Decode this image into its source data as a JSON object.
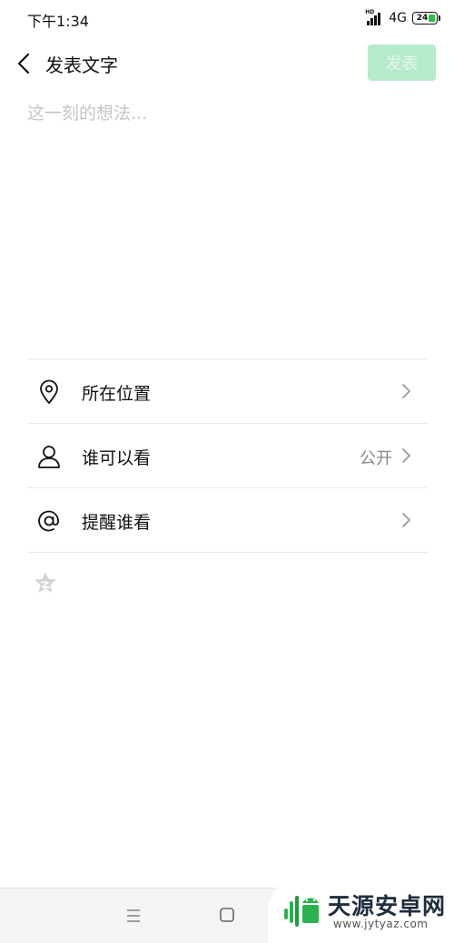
{
  "status_bar": {
    "time": "下午1:34",
    "signal_badge": "HD",
    "network": "4G",
    "battery": "24"
  },
  "header": {
    "back_icon": "chevron-left-icon",
    "title": "发表文字",
    "publish_label": "发表"
  },
  "composer": {
    "placeholder": "这一刻的想法...",
    "value": ""
  },
  "options": [
    {
      "icon": "location-pin-icon",
      "label": "所在位置",
      "value": ""
    },
    {
      "icon": "person-icon",
      "label": "谁可以看",
      "value": "公开"
    },
    {
      "icon": "at-icon",
      "label": "提醒谁看",
      "value": ""
    }
  ],
  "sticker_icon": "star-sticker-icon",
  "nav_bar": {
    "menu_icon": "menu-icon",
    "home_icon": "home-square-icon"
  },
  "watermark": {
    "title": "天源安卓网",
    "url": "www.jytyaz.com"
  },
  "colors": {
    "publish_disabled_bg": "#b5eacb",
    "battery_green": "#2cbe4a",
    "placeholder": "#c6c6c6"
  }
}
